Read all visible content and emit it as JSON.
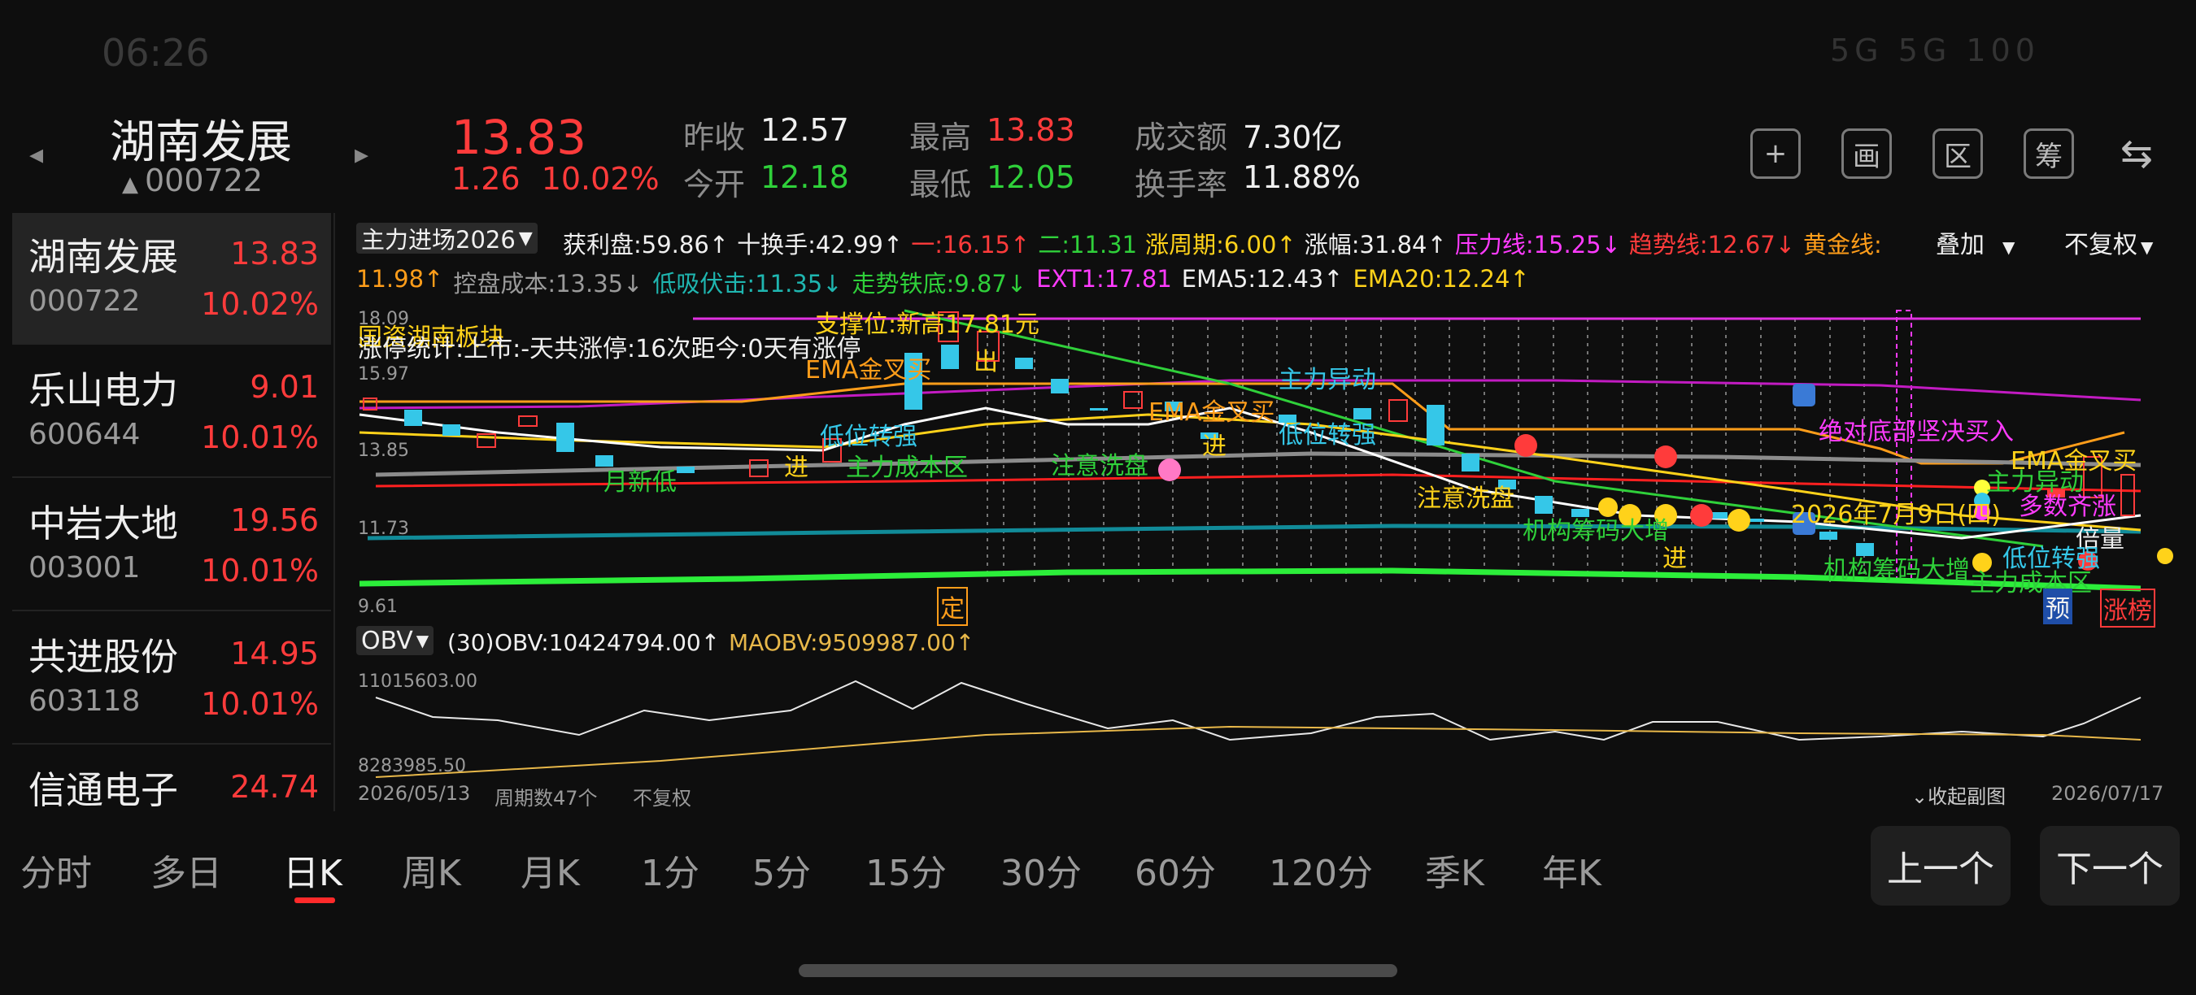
{
  "status": {
    "time": "06:26",
    "icons": "5G 5G 100"
  },
  "stock": {
    "name": "湖南发展",
    "code": "000722",
    "price": "13.83",
    "change": "1.26",
    "change_pct": "10.02%"
  },
  "quote": {
    "prev_close_label": "昨收",
    "prev_close": "12.57",
    "open_label": "今开",
    "open": "12.18",
    "high_label": "最高",
    "high": "13.83",
    "low_label": "最低",
    "low": "12.05",
    "turnover_amount_label": "成交额",
    "turnover_amount": "7.30亿",
    "turnover_rate_label": "换手率",
    "turnover_rate": "11.88%"
  },
  "toolbar": {
    "add": "+",
    "draw": "画",
    "range": "区",
    "chip": "筹",
    "device": "⇆"
  },
  "watchlist": [
    {
      "name": "湖南发展",
      "code": "000722",
      "price": "13.83",
      "pct": "10.02%"
    },
    {
      "name": "乐山电力",
      "code": "600644",
      "price": "9.01",
      "pct": "10.01%"
    },
    {
      "name": "中岩大地",
      "code": "003001",
      "price": "19.56",
      "pct": "10.01%"
    },
    {
      "name": "共进股份",
      "code": "603118",
      "price": "14.95",
      "pct": "10.01%"
    },
    {
      "name": "信通电子",
      "code": "",
      "price": "24.74",
      "pct": ""
    }
  ],
  "indicator": {
    "selector": "主力进场2026",
    "line1": [
      {
        "t": "获利盘:59.86↑",
        "c": "#f0f0f0"
      },
      {
        "t": "十换手:42.99↑",
        "c": "#f0f0f0"
      },
      {
        "t": "一:16.15↑",
        "c": "#ff3b3b"
      },
      {
        "t": "二:11.31",
        "c": "#2fd03a"
      },
      {
        "t": "涨周期:6.00↑",
        "c": "#ffd21a"
      },
      {
        "t": "涨幅:31.84↑",
        "c": "#f0f0f0"
      },
      {
        "t": "压力线:15.25↓",
        "c": "#ff3bff"
      },
      {
        "t": "趋势线:12.67↓",
        "c": "#ff3b3b"
      },
      {
        "t": "黄金线:",
        "c": "#ff9d1a"
      }
    ],
    "line2": [
      {
        "t": "11.98↑",
        "c": "#ff9d1a"
      },
      {
        "t": "控盘成本:13.35↓",
        "c": "#9a9a9a"
      },
      {
        "t": "低吸伏击:11.35↓",
        "c": "#1fb6b0"
      },
      {
        "t": "走势铁底:9.87↓",
        "c": "#2fd03a"
      },
      {
        "t": "EXT1:17.81",
        "c": "#ff3bff"
      },
      {
        "t": "EMA5:12.43↑",
        "c": "#f0f0f0"
      },
      {
        "t": "EMA20:12.24↑",
        "c": "#ffd21a"
      }
    ],
    "overlay": "叠加",
    "adjust": "不复权"
  },
  "price_axis": [
    "18.09",
    "15.97",
    "13.85",
    "11.73",
    "9.61"
  ],
  "annotations": {
    "sector": "国资湖南板块",
    "limit_stats": "涨停统计:上市:-天共涨停:16次距今:0天有涨停",
    "support": "支撑位:新高17.81元",
    "ema_cross1": "EMA金叉买",
    "out": "出",
    "main_move1": "主力异动",
    "ema_cross2": "EMA金叉买",
    "low_strong1": "低位转强",
    "low_strong2": "低位转强",
    "in1": "进",
    "in2": "进",
    "in3": "进",
    "main_cost1": "主力成本区",
    "wash1": "注意洗盘",
    "new_low": "月新低",
    "wash2": "注意洗盘",
    "inst_build": "机构筹码大增",
    "absolute_bottom": "绝对底部坚决买入",
    "ema_cross3": "EMA金叉买",
    "main_move2": "主力异动",
    "multi_aligned": "多数齐涨",
    "date_note": "2026年7月9日(四)",
    "double_vol": "倍量",
    "low_strong3": "低位转强",
    "inst_build2": "机构筹码大增",
    "main_cost2": "主力成本区",
    "fixed": "定",
    "pre": "预",
    "limit_list": "涨榜"
  },
  "obv": {
    "selector": "OBV",
    "period": "(30)",
    "obv_value": "OBV:10424794.00↑",
    "maobv_value": "MAOBV:9509987.00↑",
    "y_top": "11015603.00",
    "y_bottom": "8283985.50"
  },
  "footer": {
    "start_date": "2026/05/13",
    "period_count": "周期数47个",
    "adjust": "不复权",
    "collapse": "收起副图",
    "end_date": "2026/07/17"
  },
  "period_tabs": [
    "分时",
    "多日",
    "日K",
    "周K",
    "月K",
    "1分",
    "5分",
    "15分",
    "30分",
    "60分",
    "120分",
    "季K",
    "年K"
  ],
  "selected_tab": "日K",
  "nav": {
    "prev": "上一个",
    "next": "下一个"
  },
  "colors": {
    "up": "#ff3b3b",
    "down": "#2fd03a",
    "cyan": "#35c7e8",
    "magenta": "#ff3bff",
    "yellow": "#ffd21a"
  }
}
